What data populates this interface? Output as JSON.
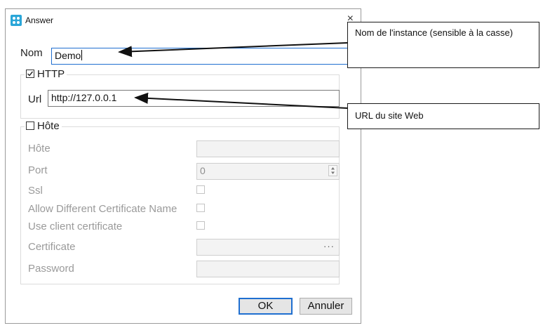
{
  "window": {
    "title": "Answer",
    "close_glyph": "×",
    "icon": "app-icon"
  },
  "form": {
    "name_label": "Nom",
    "name_value": "Demo",
    "http_group": "HTTP",
    "http_checked": true,
    "url_label": "Url",
    "url_value": "http://127.0.0.1",
    "host_group": "Hôte",
    "host_checked": false,
    "host_label": "Hôte",
    "host_value": "",
    "port_label": "Port",
    "port_value": "0",
    "ssl_label": "Ssl",
    "allow_diff_label": "Allow Different Certificate Name",
    "use_client_cert_label": "Use client certificate",
    "certificate_label": "Certificate",
    "certificate_browse": "···",
    "password_label": "Password"
  },
  "buttons": {
    "ok": "OK",
    "cancel": "Annuler"
  },
  "callouts": {
    "name_note": "Nom de l'instance (sensible à la casse)",
    "url_note": "URL du site Web"
  },
  "colors": {
    "focus_border": "#1f6fd0",
    "disabled_text": "#9a9a9a"
  }
}
